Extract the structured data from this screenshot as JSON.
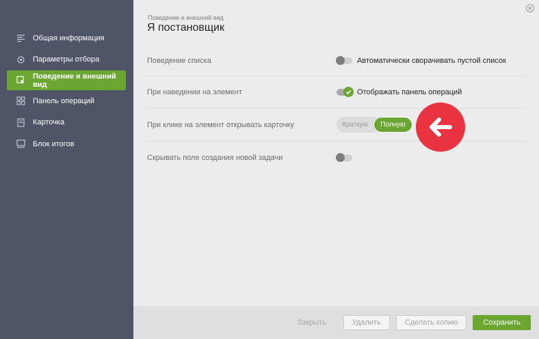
{
  "sidebar": {
    "items": [
      {
        "label": "Общая информация",
        "icon": "list-lines-icon"
      },
      {
        "label": "Параметры отбора",
        "icon": "gear-icon"
      },
      {
        "label": "Поведение и внешний вид",
        "icon": "cursor-window-icon",
        "active": true
      },
      {
        "label": "Панель операций",
        "icon": "grid-panel-icon"
      },
      {
        "label": "Карточка",
        "icon": "card-icon"
      },
      {
        "label": "Блок итогов",
        "icon": "summary-block-icon"
      }
    ]
  },
  "header": {
    "breadcrumb": "Поведение и внешний вид",
    "title": "Я постановщик"
  },
  "settings": {
    "row1": {
      "label": "Поведение списка",
      "control_text": "Автоматически сворачивать пустой список",
      "toggle_state": "off"
    },
    "row2": {
      "label": "При наведении на элемент",
      "control_text": "Отображать панель операций",
      "toggle_state": "on"
    },
    "row3": {
      "label": "При клике на элемент открывать карточку",
      "options": [
        "Краткую",
        "Полную"
      ],
      "selected": "Полную"
    },
    "row4": {
      "label": "Скрывать поле создания новой задачи",
      "toggle_state": "off"
    }
  },
  "footer": {
    "close_label": "Закрыть",
    "delete_label": "Удалить",
    "copy_label": "Сделать копию",
    "save_label": "Сохранить"
  },
  "colors": {
    "accent": "#6ba532",
    "sidebar_bg": "#4f5566",
    "highlight_badge": "#ea3340"
  }
}
